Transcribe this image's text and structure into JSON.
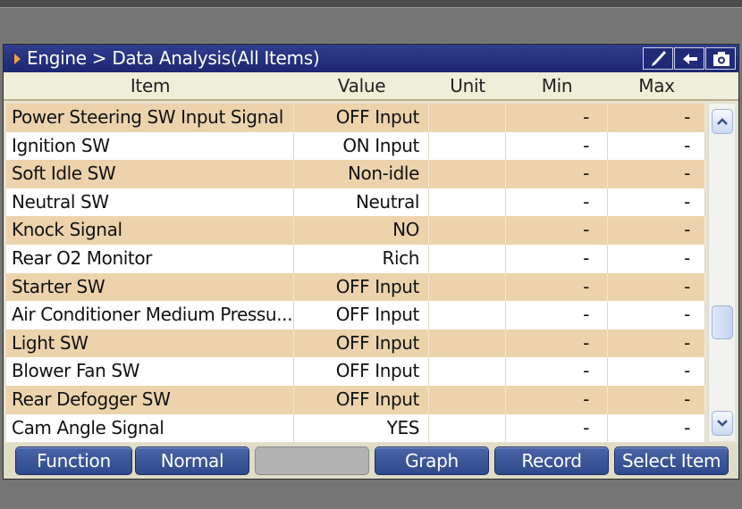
{
  "title": "Engine > Data Analysis(All Items)",
  "toolbar_icons": [
    "brush-icon",
    "back-arrow-icon",
    "camera-icon"
  ],
  "columns": {
    "item": "Item",
    "value": "Value",
    "unit": "Unit",
    "min": "Min",
    "max": "Max"
  },
  "rows": [
    {
      "item": "Power Steering SW Input Signal",
      "value": "OFF Input",
      "unit": "",
      "min": "-",
      "max": "-"
    },
    {
      "item": "Ignition SW",
      "value": "ON Input",
      "unit": "",
      "min": "-",
      "max": "-"
    },
    {
      "item": "Soft Idle SW",
      "value": "Non-idle",
      "unit": "",
      "min": "-",
      "max": "-"
    },
    {
      "item": "Neutral SW",
      "value": "Neutral",
      "unit": "",
      "min": "-",
      "max": "-"
    },
    {
      "item": "Knock Signal",
      "value": "NO",
      "unit": "",
      "min": "-",
      "max": "-"
    },
    {
      "item": "Rear O2 Monitor",
      "value": "Rich",
      "unit": "",
      "min": "-",
      "max": "-"
    },
    {
      "item": "Starter SW",
      "value": "OFF Input",
      "unit": "",
      "min": "-",
      "max": "-"
    },
    {
      "item": "Air Conditioner Medium Pressu...",
      "value": "OFF Input",
      "unit": "",
      "min": "-",
      "max": "-"
    },
    {
      "item": "Light SW",
      "value": "OFF Input",
      "unit": "",
      "min": "-",
      "max": "-"
    },
    {
      "item": "Blower Fan SW",
      "value": "OFF Input",
      "unit": "",
      "min": "-",
      "max": "-"
    },
    {
      "item": "Rear Defogger SW",
      "value": "OFF Input",
      "unit": "",
      "min": "-",
      "max": "-"
    },
    {
      "item": "Cam Angle Signal",
      "value": "YES",
      "unit": "",
      "min": "-",
      "max": "-"
    }
  ],
  "buttons": [
    {
      "label": "Function",
      "enabled": true
    },
    {
      "label": "Normal",
      "enabled": true
    },
    {
      "label": "",
      "enabled": false
    },
    {
      "label": "Graph",
      "enabled": true
    },
    {
      "label": "Record",
      "enabled": true
    },
    {
      "label": "Select Item",
      "enabled": true
    }
  ],
  "colors": {
    "title_bar": "#1c2772",
    "title_arrow": "#f0a23a",
    "row_highlight": "#ecd3ac",
    "row_plain": "#ffffff",
    "button": "#3a559a",
    "button_disabled": "#b3b3b3"
  }
}
